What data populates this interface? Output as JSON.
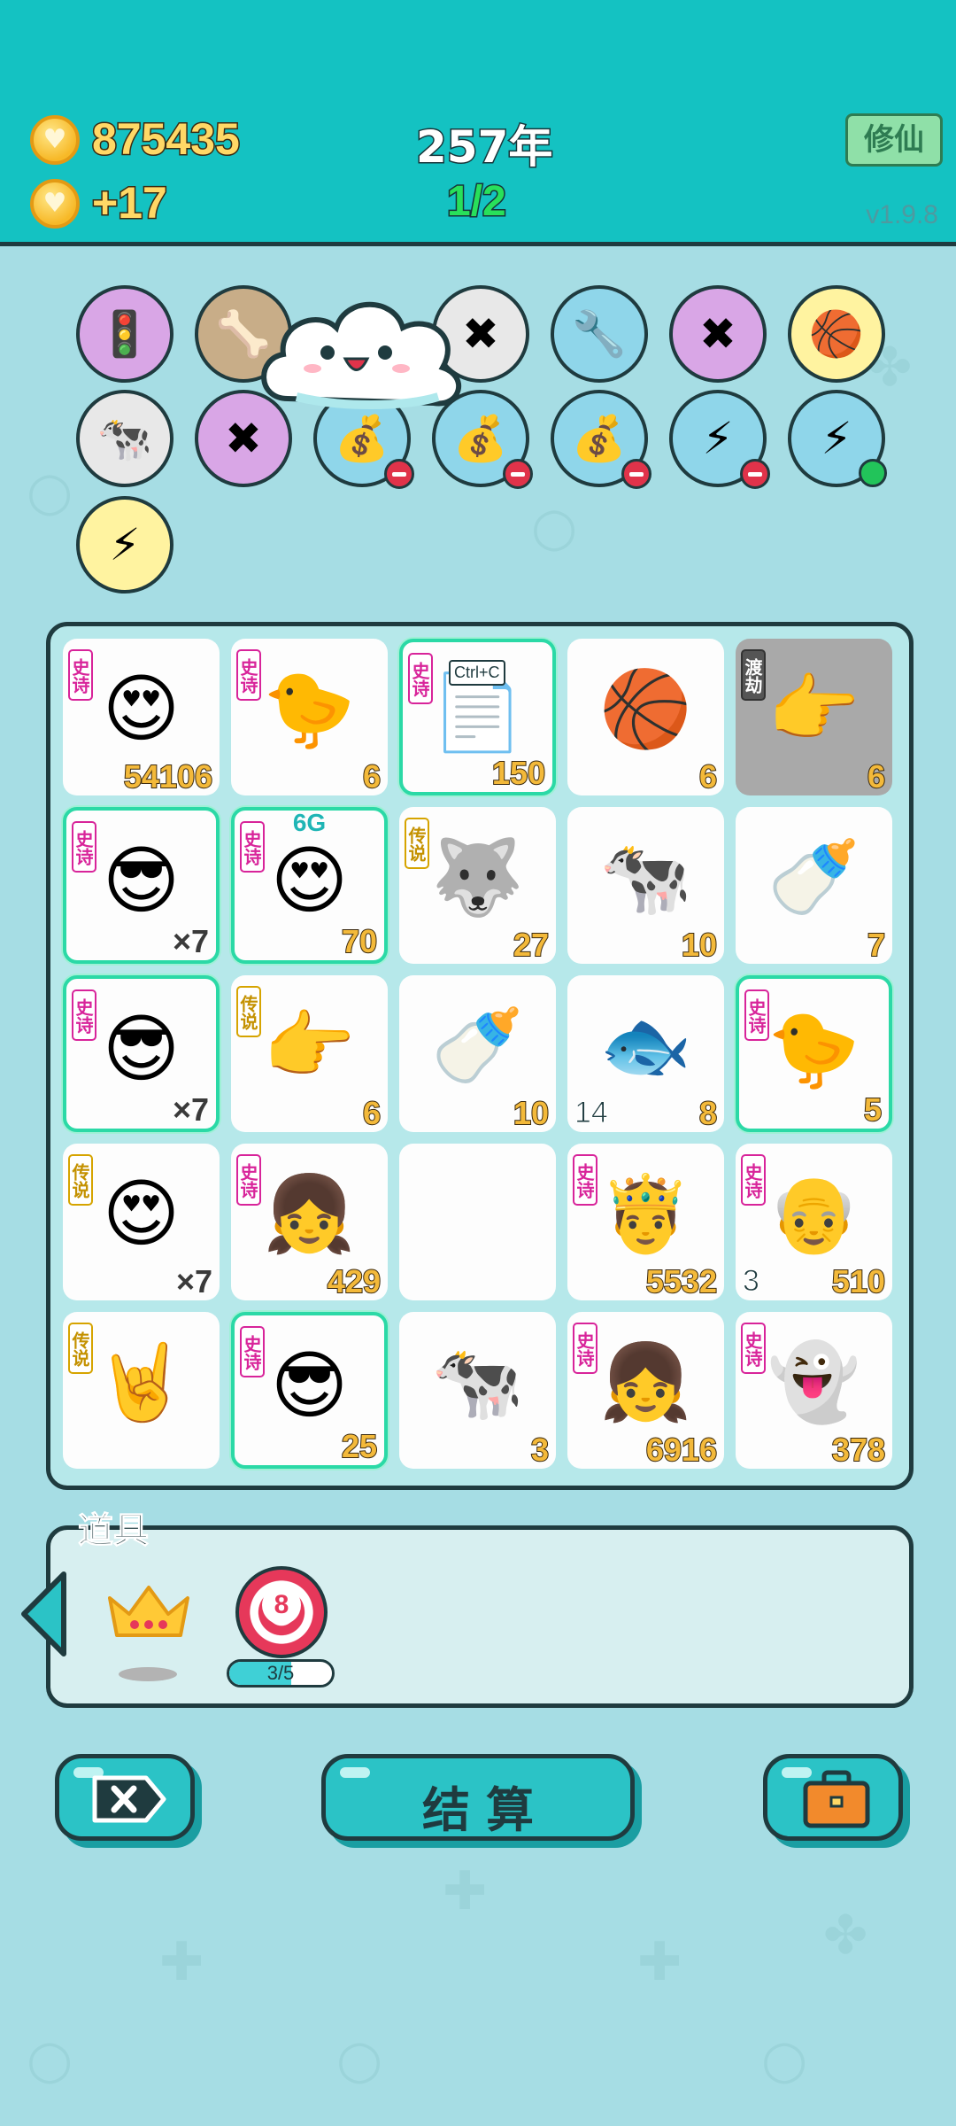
{
  "header": {
    "coins": "875435",
    "income": "+17",
    "year": "257年",
    "wave": "1/2",
    "mode_button": "修仙",
    "version": "v1.9.8"
  },
  "skills": [
    {
      "icon": "ghost-signal-icon",
      "color": "#d9a6e6"
    },
    {
      "icon": "dog-bowl-icon",
      "color": "#c8ad88"
    },
    {
      "icon": "close-tag-icon",
      "color": "#e8e8e8"
    },
    {
      "icon": "shield-wrench-icon",
      "color": "#8fd6ea"
    },
    {
      "icon": "math-guy-icon",
      "color": "#d9a6e6"
    },
    {
      "icon": "basketballs-icon",
      "color": "#fff3a0"
    },
    {
      "icon": "cow-girls-icon",
      "color": "#e8e8e8"
    },
    {
      "icon": "math-guy-icon",
      "color": "#d9a6e6"
    },
    {
      "icon": "money-bag-icon",
      "color": "#8fd6ea"
    },
    {
      "icon": "money-bag-icon",
      "color": "#8fd6ea"
    },
    {
      "icon": "money-bag-icon",
      "color": "#8fd6ea"
    },
    {
      "icon": "lightning-plant-icon",
      "color": "#8fd6ea"
    },
    {
      "icon": "lightning-plant-icon",
      "color": "#8fd6ea"
    },
    {
      "icon": "lightning-icon",
      "color": "#fff3a0"
    }
  ],
  "board": {
    "cells": [
      {
        "icon": "heart-face-icon",
        "tag": "史诗",
        "value": "54106"
      },
      {
        "icon": "chick-icon",
        "tag": "史诗",
        "value": "6"
      },
      {
        "icon": "ctrl-c-icon",
        "tag": "史诗",
        "value": "150",
        "label": "Ctrl+C"
      },
      {
        "icon": "basketball-board-icon",
        "value": "6"
      },
      {
        "icon": "pointing-hand-icon",
        "tag": "渡劫",
        "value": "6"
      },
      {
        "icon": "green-hair-face-icon",
        "tag": "史诗",
        "value": "×7"
      },
      {
        "icon": "bald-glasses-face-icon",
        "tag": "史诗",
        "value": "70",
        "top": "6G"
      },
      {
        "icon": "husky-king-icon",
        "tag": "传说",
        "value": "27"
      },
      {
        "icon": "cow-basketball-icon",
        "value": "10"
      },
      {
        "icon": "milk-bottle-icon",
        "value": "7"
      },
      {
        "icon": "green-hair-face-icon",
        "tag": "史诗",
        "value": "×7"
      },
      {
        "icon": "pointing-hand-icon",
        "tag": "传说",
        "value": "6"
      },
      {
        "icon": "milk-bottle-icon",
        "value": "10"
      },
      {
        "icon": "fish-icon",
        "value": "8",
        "sub": "14"
      },
      {
        "icon": "chick-icon",
        "tag": "史诗",
        "value": "5"
      },
      {
        "icon": "bald-old-face-icon",
        "tag": "传说",
        "value": "×7"
      },
      {
        "icon": "braid-girl-icon",
        "tag": "史诗",
        "value": "429"
      },
      {
        "icon": "empty",
        "value": ""
      },
      {
        "icon": "crown-green-face-icon",
        "tag": "史诗",
        "value": "5532"
      },
      {
        "icon": "old-glasses-face-icon",
        "tag": "史诗",
        "value": "510",
        "sub": "3"
      },
      {
        "icon": "rock-hand-icon",
        "tag": "传说",
        "value": ""
      },
      {
        "icon": "green-hair-face-icon",
        "tag": "史诗",
        "value": "25"
      },
      {
        "icon": "cow-icon",
        "value": "3"
      },
      {
        "icon": "braid-girl-icon",
        "tag": "史诗",
        "value": "6916"
      },
      {
        "icon": "ghost-icon",
        "tag": "史诗",
        "value": "378"
      }
    ]
  },
  "items": {
    "title": "道具",
    "target_number": "8",
    "progress_text": "3/5",
    "progress": 0.6
  },
  "buttons": {
    "settle": "结算"
  }
}
